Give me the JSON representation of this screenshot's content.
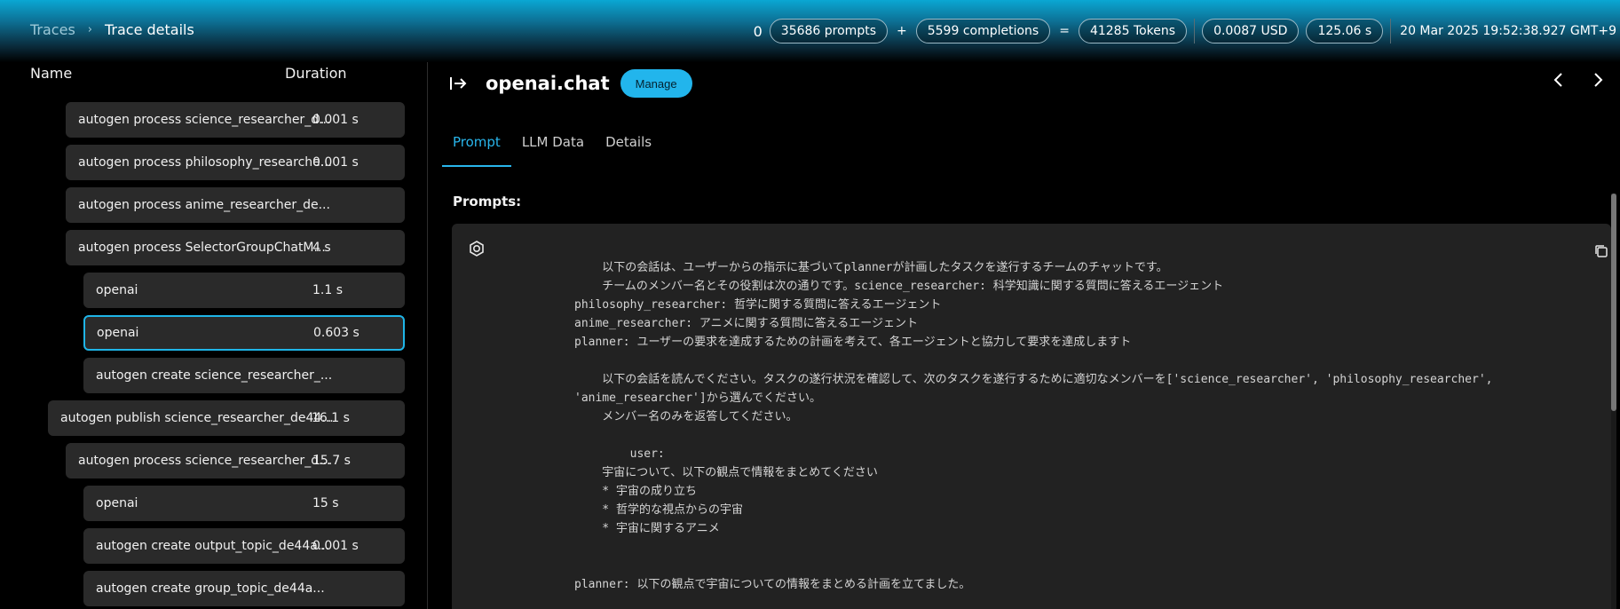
{
  "breadcrumb": {
    "root": "Traces",
    "separator": "›",
    "current": "Trace details"
  },
  "stats": {
    "count": "0",
    "prompts": "35686 prompts",
    "plus": "+",
    "completions": "5599 completions",
    "equals": "=",
    "tokens": "41285 Tokens",
    "cost": "0.0087 USD",
    "duration": "125.06 s",
    "timestamp": "20 Mar 2025 19:52:38.927 GMT+9"
  },
  "columns": {
    "name": "Name",
    "duration": "Duration"
  },
  "tree": [
    {
      "name": "autogen process science_researcher_d...",
      "duration": "0.001 s",
      "level": 2
    },
    {
      "name": "autogen process philosophy_researche...",
      "duration": "0.001 s",
      "level": 2
    },
    {
      "name": "autogen process anime_researcher_de...",
      "duration": "",
      "level": 2
    },
    {
      "name": "autogen process SelectorGroupChatM...",
      "duration": "4 s",
      "level": 2
    },
    {
      "name": "openai",
      "duration": "1.1 s",
      "level": 3
    },
    {
      "name": "openai",
      "duration": "0.603 s",
      "level": 3,
      "selected": true
    },
    {
      "name": "autogen create science_researcher_...",
      "duration": "",
      "level": 3
    },
    {
      "name": "autogen publish science_researcher_de44...",
      "duration": "16.1 s",
      "level": 1
    },
    {
      "name": "autogen process science_researcher_d...",
      "duration": "15.7 s",
      "level": 2
    },
    {
      "name": "openai",
      "duration": "15 s",
      "level": 3
    },
    {
      "name": "autogen create output_topic_de44a...",
      "duration": "0.001 s",
      "level": 3
    },
    {
      "name": "autogen create group_topic_de44a...",
      "duration": "",
      "level": 3
    }
  ],
  "panel": {
    "title": "openai.chat",
    "manage_label": "Manage",
    "tabs": [
      "Prompt",
      "LLM Data",
      "Details"
    ],
    "active_tab": 0,
    "prompts_label": "Prompts:",
    "prompt_text": "    以下の会話は、ユーザーからの指示に基づいてplannerが計画したタスクを遂行するチームのチャットです。\n    チームのメンバー名とその役割は次の通りです。science_researcher: 科学知識に関する質問に答えるエージェント\nphilosophy_researcher: 哲学に関する質問に答えるエージェント\nanime_researcher: アニメに関する質問に答えるエージェント\nplanner: ユーザーの要求を達成するための計画を考えて、各エージェントと協力して要求を達成しますト\n\n    以下の会話を読んでください。タスクの遂行状況を確認して、次のタスクを遂行するために適切なメンバーを['science_researcher', 'philosophy_researcher',\n'anime_researcher']から選んでください。\n    メンバー名のみを返答してください。\n\n        user:\n    宇宙について、以下の観点で情報をまとめてください\n    * 宇宙の成り立ち\n    * 哲学的な視点からの宇宙\n    * 宇宙に関するアニメ\n\n\nplanner: 以下の観点で宇宙についての情報をまとめる計画を立てました。"
  },
  "icons": {
    "enter": "enter-arrow-icon",
    "prev": "chevron-left-icon",
    "next": "chevron-right-icon",
    "role": "openai-logo-icon",
    "copy": "copy-icon"
  },
  "colors": {
    "accent": "#22b5ec",
    "row_bg": "#2a2a2a",
    "panel_bg": "#222222"
  }
}
